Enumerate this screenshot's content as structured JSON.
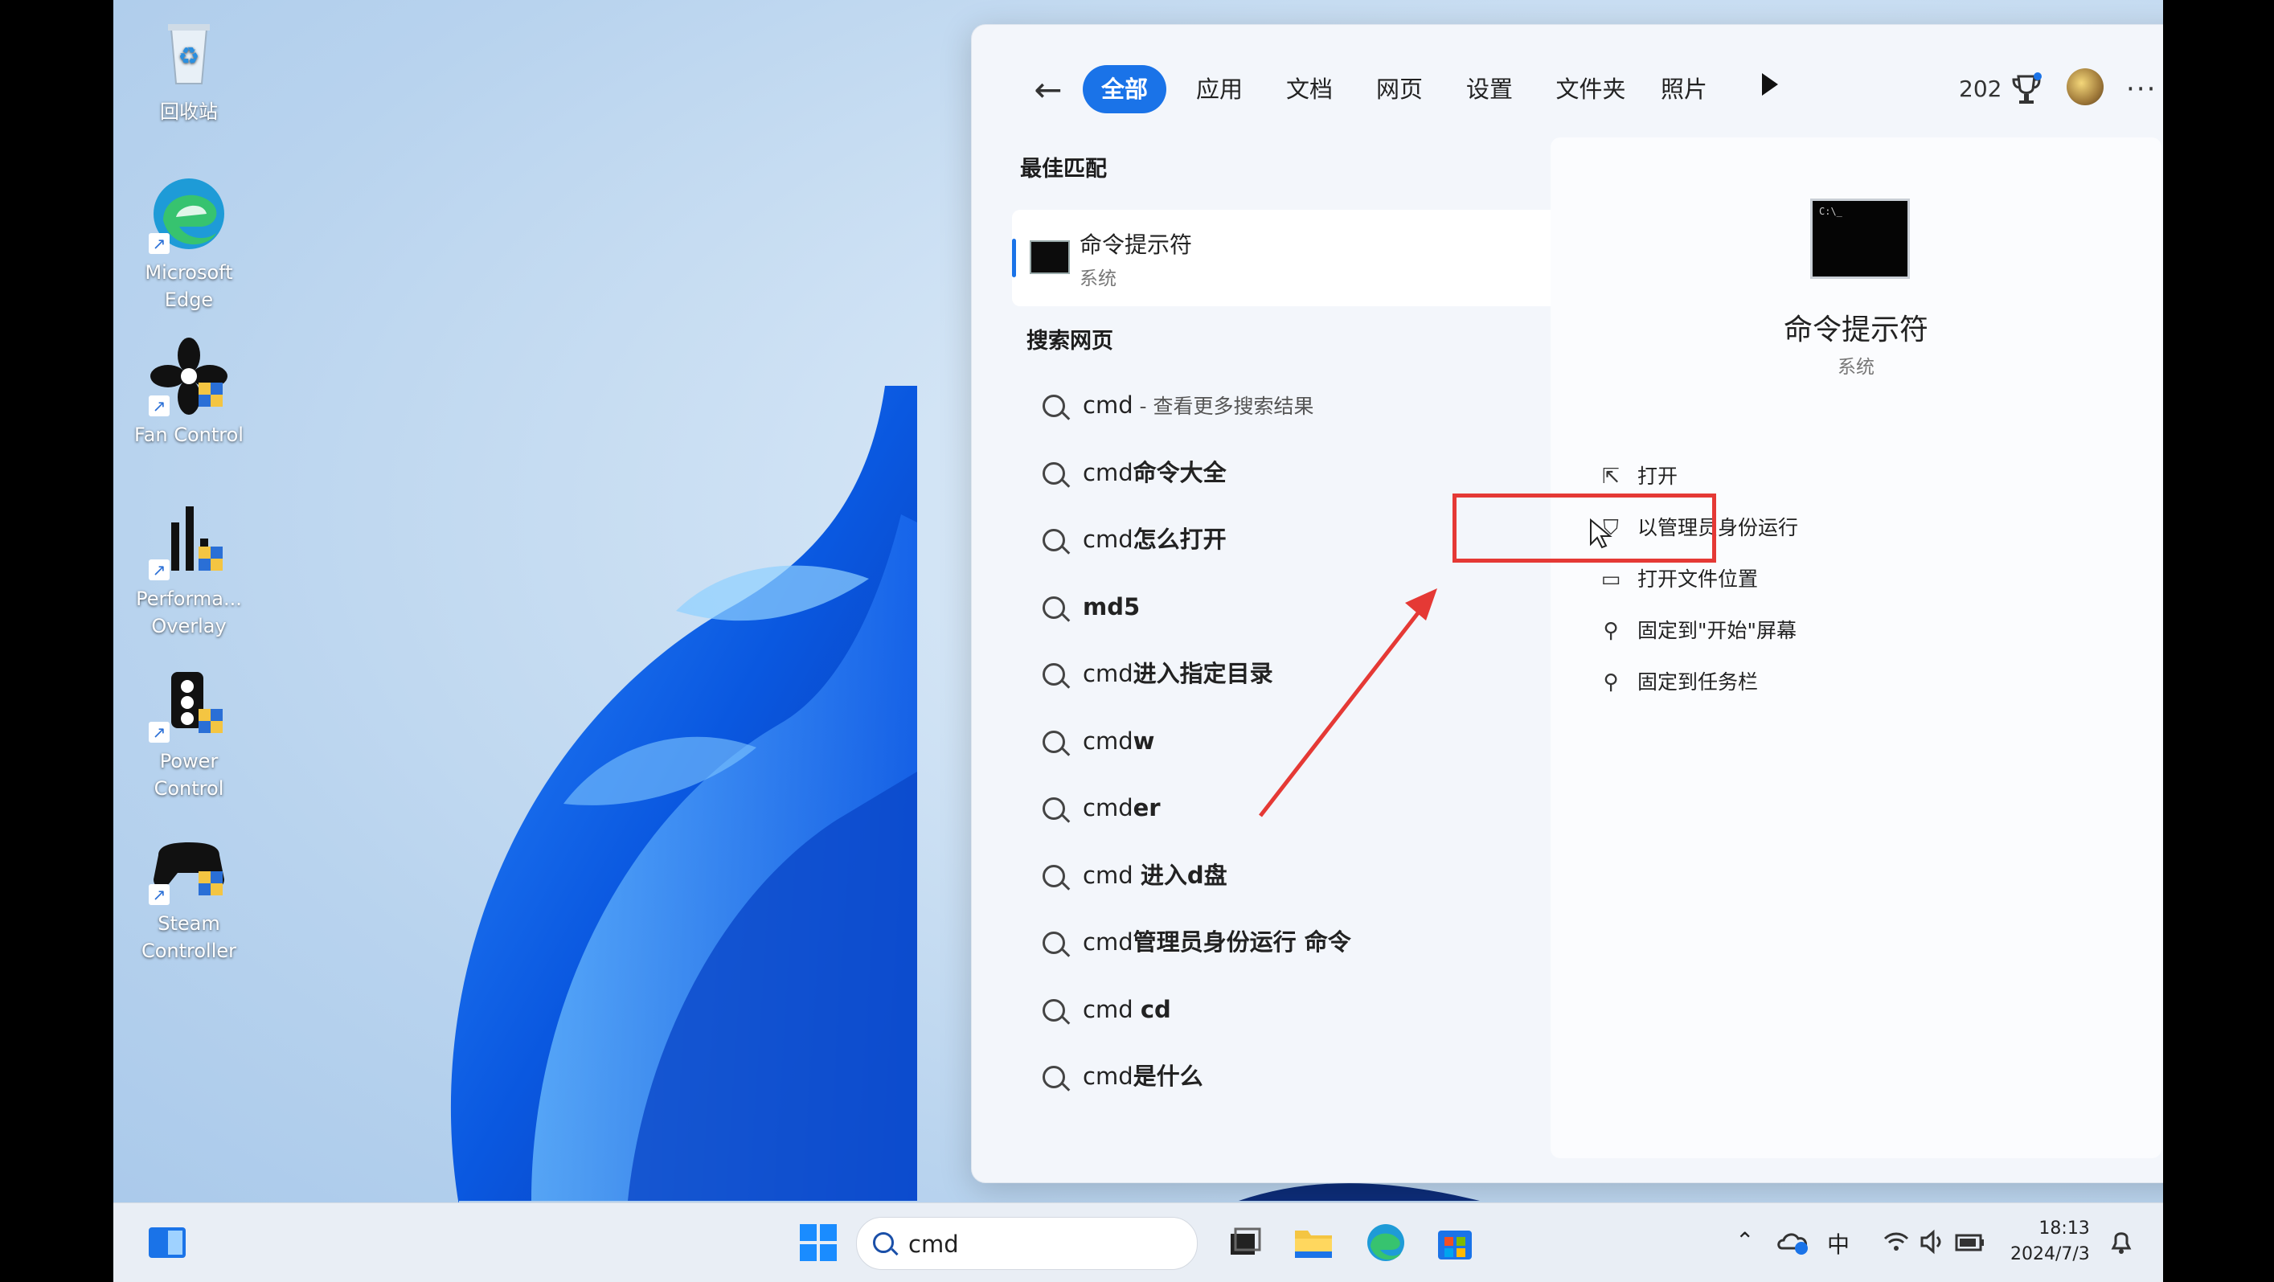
{
  "desktop": {
    "icons": [
      {
        "label": "回收站",
        "icon": "recycle-bin-icon"
      },
      {
        "label": "Microsoft Edge",
        "icon": "edge-icon"
      },
      {
        "label": "Fan Control",
        "icon": "fan-icon"
      },
      {
        "label": "Performa... Overlay",
        "icon": "performance-overlay-icon"
      },
      {
        "label": "Power Control",
        "icon": "power-control-icon"
      },
      {
        "label": "Steam Controller",
        "icon": "gamepad-icon"
      }
    ]
  },
  "search_panel": {
    "tabs": [
      "全部",
      "应用",
      "文档",
      "网页",
      "设置",
      "文件夹",
      "照片"
    ],
    "active_tab": "全部",
    "reward_count": "202",
    "best_match_title": "最佳匹配",
    "best_match": {
      "name": "命令提示符",
      "sub": "系统"
    },
    "web_title": "搜索网页",
    "suggestions": [
      {
        "pre": "cmd",
        "bold": "",
        "tail": " - 查看更多搜索结果"
      },
      {
        "pre": "cmd",
        "bold": "命令大全",
        "tail": ""
      },
      {
        "pre": "cmd",
        "bold": "怎么打开",
        "tail": ""
      },
      {
        "pre": "",
        "bold": "md5",
        "tail": ""
      },
      {
        "pre": "cmd",
        "bold": "进入指定目录",
        "tail": ""
      },
      {
        "pre": "cmd",
        "bold": "w",
        "tail": ""
      },
      {
        "pre": "cmd",
        "bold": "er",
        "tail": ""
      },
      {
        "pre": "cmd ",
        "bold": "进入d盘",
        "tail": ""
      },
      {
        "pre": "cmd",
        "bold": "管理员身份运行 命令",
        "tail": ""
      },
      {
        "pre": "cmd ",
        "bold": "cd",
        "tail": ""
      },
      {
        "pre": "cmd",
        "bold": "是什么",
        "tail": ""
      }
    ],
    "detail": {
      "title": "命令提示符",
      "sub": "系统",
      "actions": [
        {
          "label": "打开",
          "icon": "open-external-icon"
        },
        {
          "label": "以管理员身份运行",
          "icon": "admin-shield-icon"
        },
        {
          "label": "打开文件位置",
          "icon": "folder-icon"
        },
        {
          "label": "固定到\"开始\"屏幕",
          "icon": "pin-icon"
        },
        {
          "label": "固定到任务栏",
          "icon": "pin-icon"
        }
      ]
    }
  },
  "taskbar": {
    "search_value": "cmd",
    "ime": "中",
    "time": "18:13",
    "date": "2024/7/3"
  },
  "colors": {
    "accent": "#1a73e8",
    "highlight_box": "#e53935"
  }
}
